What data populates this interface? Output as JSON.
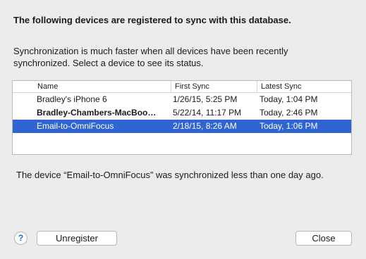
{
  "dialog": {
    "heading": "The following devices are registered to sync with this database.",
    "description": "Synchronization is much faster when all devices have been recently synchronized. Select a device to see its status.",
    "status_message": "The device “Email-to-OmniFocus” was synchronized less than one day ago."
  },
  "table": {
    "columns": [
      "Name",
      "First Sync",
      "Latest Sync"
    ],
    "rows": [
      {
        "name": "Bradley's iPhone 6",
        "first_sync": "1/26/15, 5:25 PM",
        "latest_sync": "Today, 1:04 PM",
        "bold": false,
        "selected": false
      },
      {
        "name": "Bradley-Chambers-MacBoo…",
        "first_sync": "5/22/14, 11:17 PM",
        "latest_sync": "Today, 2:46 PM",
        "bold": true,
        "selected": false
      },
      {
        "name": "Email-to-OmniFocus",
        "first_sync": "2/18/15, 8:26 AM",
        "latest_sync": "Today, 1:06 PM",
        "bold": false,
        "selected": true
      }
    ]
  },
  "buttons": {
    "help": "?",
    "unregister": "Unregister",
    "close": "Close"
  },
  "colors": {
    "selection": "#2f64d1",
    "window_bg": "#ececec"
  }
}
